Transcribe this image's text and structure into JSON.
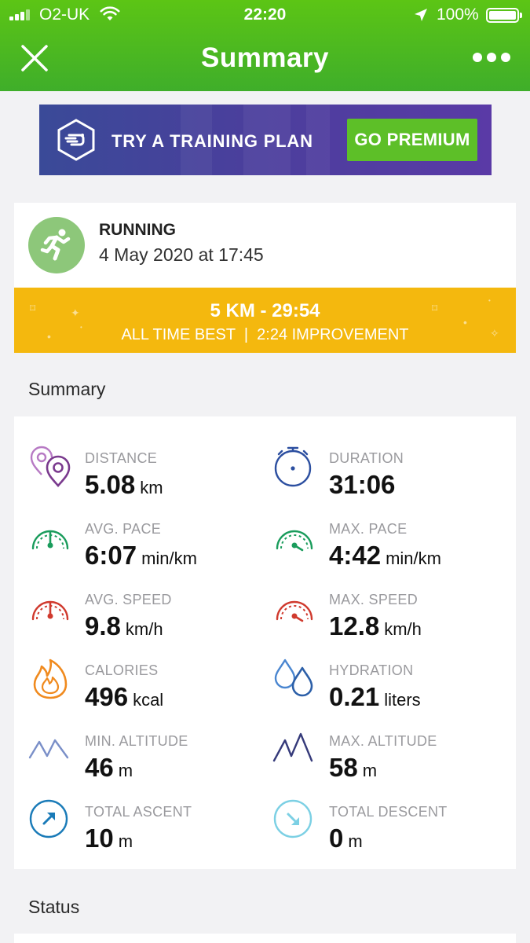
{
  "status_bar": {
    "carrier": "O2-UK",
    "time": "22:20",
    "battery": "100%"
  },
  "nav": {
    "title": "Summary",
    "close_icon": "close-icon",
    "more_icon": "more-horizontal-icon"
  },
  "promo": {
    "text": "TRY A TRAINING PLAN",
    "button": "GO PREMIUM"
  },
  "activity": {
    "type": "RUNNING",
    "date": "4 May 2020 at 17:45",
    "best_title": "5 KM - 29:54",
    "best_subtitle": "ALL TIME BEST  |  2:24 IMPROVEMENT"
  },
  "summary_section": {
    "title": "Summary",
    "stats": [
      {
        "label": "DISTANCE",
        "value": "5.08",
        "unit": "km",
        "icon": "location-pins-icon"
      },
      {
        "label": "DURATION",
        "value": "31:06",
        "unit": "",
        "icon": "stopwatch-icon"
      },
      {
        "label": "AVG. PACE",
        "value": "6:07",
        "unit": "min/km",
        "icon": "avg-pace-gauge-icon"
      },
      {
        "label": "MAX. PACE",
        "value": "4:42",
        "unit": "min/km",
        "icon": "max-pace-gauge-icon"
      },
      {
        "label": "AVG. SPEED",
        "value": "9.8",
        "unit": "km/h",
        "icon": "avg-speed-gauge-icon"
      },
      {
        "label": "MAX. SPEED",
        "value": "12.8",
        "unit": "km/h",
        "icon": "max-speed-gauge-icon"
      },
      {
        "label": "CALORIES",
        "value": "496",
        "unit": "kcal",
        "icon": "flame-icon"
      },
      {
        "label": "HYDRATION",
        "value": "0.21",
        "unit": "liters",
        "icon": "water-drops-icon"
      },
      {
        "label": "MIN. ALTITUDE",
        "value": "46",
        "unit": "m",
        "icon": "min-altitude-mountain-icon"
      },
      {
        "label": "MAX. ALTITUDE",
        "value": "58",
        "unit": "m",
        "icon": "max-altitude-mountain-icon"
      },
      {
        "label": "TOTAL ASCENT",
        "value": "10",
        "unit": "m",
        "icon": "ascent-arrow-icon"
      },
      {
        "label": "TOTAL DESCENT",
        "value": "0",
        "unit": "m",
        "icon": "descent-arrow-icon"
      }
    ]
  },
  "status_section": {
    "title": "Status"
  },
  "colors": {
    "header_green": "#4cb81f",
    "best_yellow": "#f4b80e",
    "premium_green": "#5dbf28",
    "promo_purple": "#4a3f9c"
  }
}
